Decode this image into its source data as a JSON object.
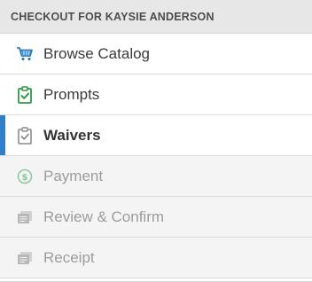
{
  "header": {
    "title": "CHECKOUT FOR KAYSIE ANDERSON"
  },
  "steps": [
    {
      "label": "Browse Catalog",
      "icon": "cart-icon",
      "state": "done"
    },
    {
      "label": "Prompts",
      "icon": "clipboard-check-icon",
      "state": "done"
    },
    {
      "label": "Waivers",
      "icon": "clipboard-check-icon",
      "state": "current"
    },
    {
      "label": "Payment",
      "icon": "dollar-coin-icon",
      "state": "pending"
    },
    {
      "label": "Review & Confirm",
      "icon": "documents-icon",
      "state": "pending"
    },
    {
      "label": "Receipt",
      "icon": "documents-icon",
      "state": "pending"
    }
  ],
  "colors": {
    "active_accent": "#2f80c9",
    "cart": "#2b7fc3",
    "prompts_check": "#2e9a44",
    "pending_icon": "#b4b4b4",
    "payment_icon": "#8cc79b"
  }
}
